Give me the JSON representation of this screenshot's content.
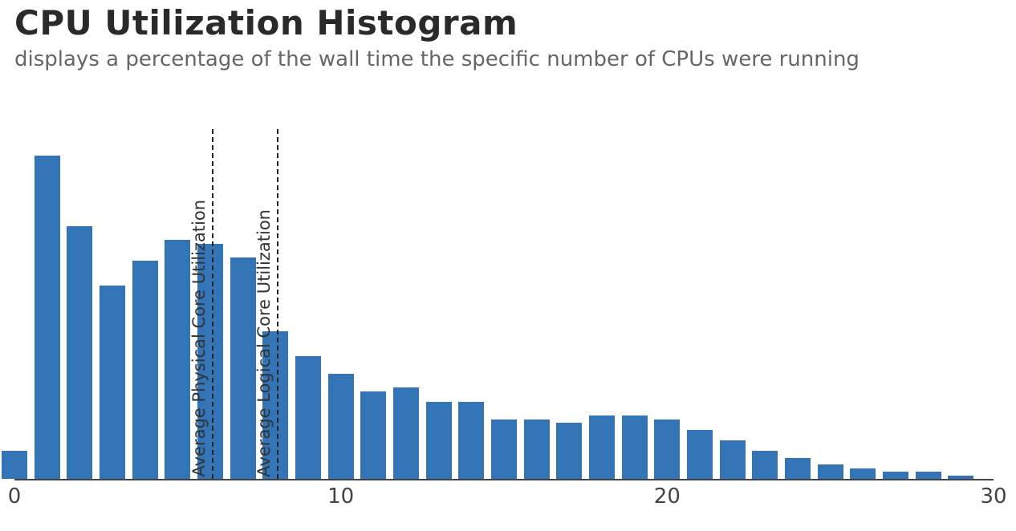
{
  "title": "CPU Utilization Histogram",
  "subtitle": "displays a percentage of the wall time the specific number of CPUs were running",
  "chart_data": {
    "type": "bar",
    "categories": [
      0,
      1,
      2,
      3,
      4,
      5,
      6,
      7,
      8,
      9,
      10,
      11,
      12,
      13,
      14,
      15,
      16,
      17,
      18,
      19,
      20,
      21,
      22,
      23,
      24,
      25,
      26,
      27,
      28,
      29
    ],
    "values": [
      8,
      92,
      72,
      55,
      62,
      68,
      67,
      63,
      42,
      35,
      30,
      25,
      26,
      22,
      22,
      17,
      17,
      16,
      18,
      18,
      17,
      14,
      11,
      8,
      6,
      4,
      3,
      2,
      2,
      1
    ],
    "x_ticks": [
      0,
      10,
      20,
      30
    ],
    "ylim": [
      0,
      100
    ],
    "bar_color": "#3274b5",
    "reference_lines": [
      {
        "x": 6.05,
        "label": "Average Physical Core Utilization"
      },
      {
        "x": 8.05,
        "label": "Average Logical Core Utilization"
      }
    ]
  }
}
